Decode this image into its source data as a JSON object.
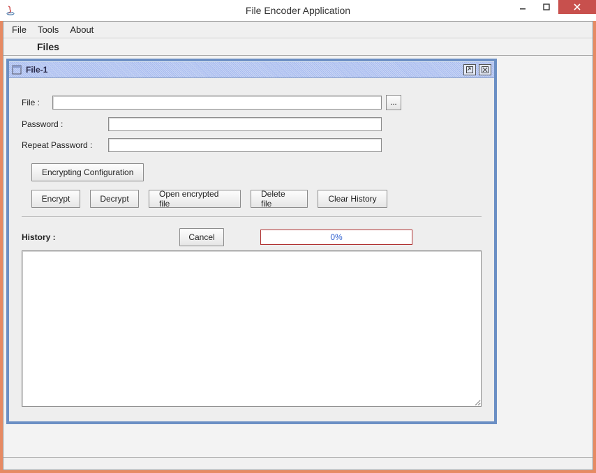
{
  "window": {
    "title": "File Encoder Application"
  },
  "menu": {
    "file": "File",
    "tools": "Tools",
    "about": "About",
    "heading": "Files"
  },
  "frame": {
    "title": "File-1",
    "labels": {
      "file": "File :",
      "password": "Password :",
      "repeat": "Repeat Password :",
      "history": "History :"
    },
    "buttons": {
      "browse": "...",
      "config": "Encrypting Configuration",
      "encrypt": "Encrypt",
      "decrypt": "Decrypt",
      "open": "Open encrypted file",
      "delete": "Delete file",
      "clear": "Clear History",
      "cancel": "Cancel"
    },
    "progress": "0%",
    "values": {
      "file": "",
      "password": "",
      "repeat": ""
    }
  }
}
